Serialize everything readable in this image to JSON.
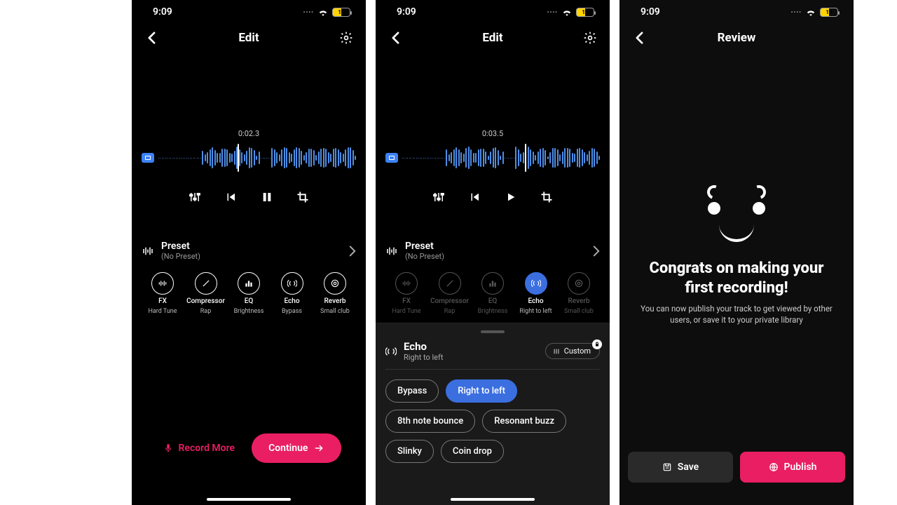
{
  "status": {
    "time": "9:09",
    "battery": "19"
  },
  "screen1": {
    "title": "Edit",
    "timecode": "0:02.3",
    "preset": {
      "label": "Preset",
      "value": "(No Preset)"
    },
    "fx": [
      {
        "name": "FX",
        "sub": "Hard Tune"
      },
      {
        "name": "Compressor",
        "sub": "Rap"
      },
      {
        "name": "EQ",
        "sub": "Brightness"
      },
      {
        "name": "Echo",
        "sub": "Bypass"
      },
      {
        "name": "Reverb",
        "sub": "Small club"
      }
    ],
    "record_more": "Record More",
    "continue": "Continue"
  },
  "screen2": {
    "title": "Edit",
    "timecode": "0:03.5",
    "preset": {
      "label": "Preset",
      "value": "(No Preset)"
    },
    "fx": [
      {
        "name": "FX",
        "sub": "Hard Tune"
      },
      {
        "name": "Compressor",
        "sub": "Rap"
      },
      {
        "name": "EQ",
        "sub": "Brightness"
      },
      {
        "name": "Echo",
        "sub": "Right to left"
      },
      {
        "name": "Reverb",
        "sub": "Small club"
      }
    ],
    "panel": {
      "title": "Echo",
      "subtitle": "Right to left",
      "custom": "Custom",
      "options": [
        "Bypass",
        "Right to left",
        "8th note bounce",
        "Resonant buzz",
        "Slinky",
        "Coin drop"
      ],
      "active": "Right to left"
    }
  },
  "screen3": {
    "title": "Review",
    "heading": "Congrats on making your first recording!",
    "subtext": "You can now publish your track to get viewed by other users, or save it to your private library",
    "save": "Save",
    "publish": "Publish"
  }
}
